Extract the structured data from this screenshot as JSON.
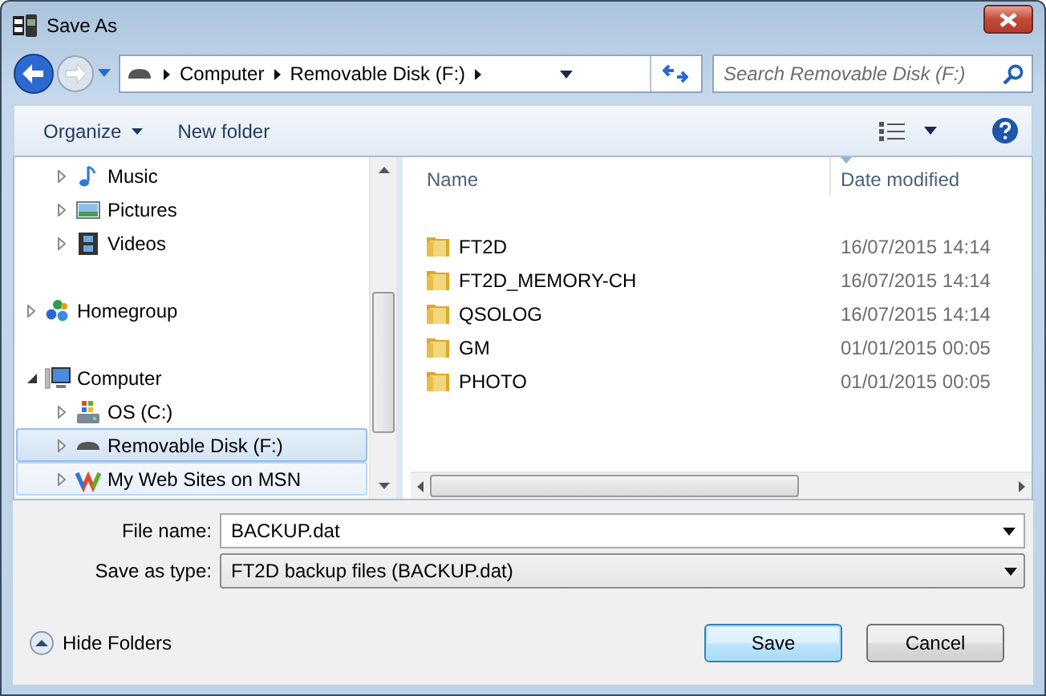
{
  "window": {
    "title": "Save As"
  },
  "address": {
    "breadcrumbs": [
      "Computer",
      "Removable Disk (F:)"
    ],
    "search_placeholder": "Search Removable Disk (F:)"
  },
  "toolbar": {
    "organize": "Organize",
    "new_folder": "New folder"
  },
  "nav_tree": [
    {
      "children": [
        {
          "label": "Music",
          "kind": "music",
          "expanded": false,
          "selected": false,
          "hot": false
        },
        {
          "label": "Pictures",
          "kind": "pictures",
          "expanded": false,
          "selected": false,
          "hot": false
        },
        {
          "label": "Videos",
          "kind": "videos",
          "expanded": false,
          "selected": false,
          "hot": false
        }
      ]
    },
    {
      "label": "Homegroup",
      "kind": "homegroup",
      "expanded": false,
      "selected": false,
      "hot": false
    },
    {
      "label": "Computer",
      "kind": "computer",
      "expanded": true,
      "selected": false,
      "hot": false,
      "children": [
        {
          "label": "OS (C:)",
          "kind": "drive-os",
          "expanded": false,
          "selected": false,
          "hot": false
        },
        {
          "label": "Removable Disk (F:)",
          "kind": "drive-removable",
          "expanded": false,
          "selected": true,
          "hot": false
        },
        {
          "label": "My Web Sites on MSN",
          "kind": "web",
          "expanded": false,
          "selected": false,
          "hot": true
        }
      ]
    }
  ],
  "file_list": {
    "columns": [
      "Name",
      "Date modified"
    ],
    "rows": [
      {
        "name": "FT2D",
        "date": "16/07/2015 14:14"
      },
      {
        "name": "FT2D_MEMORY-CH",
        "date": "16/07/2015 14:14"
      },
      {
        "name": "QSOLOG",
        "date": "16/07/2015 14:14"
      },
      {
        "name": "GM",
        "date": "01/01/2015 00:05"
      },
      {
        "name": "PHOTO",
        "date": "01/01/2015 00:05"
      }
    ]
  },
  "form": {
    "file_name_label": "File name:",
    "file_name": "BACKUP.dat",
    "type_label": "Save as type:",
    "type": "FT2D backup files (BACKUP.dat)"
  },
  "hide_folders": "Hide Folders",
  "buttons": [
    "Save",
    "Cancel"
  ]
}
